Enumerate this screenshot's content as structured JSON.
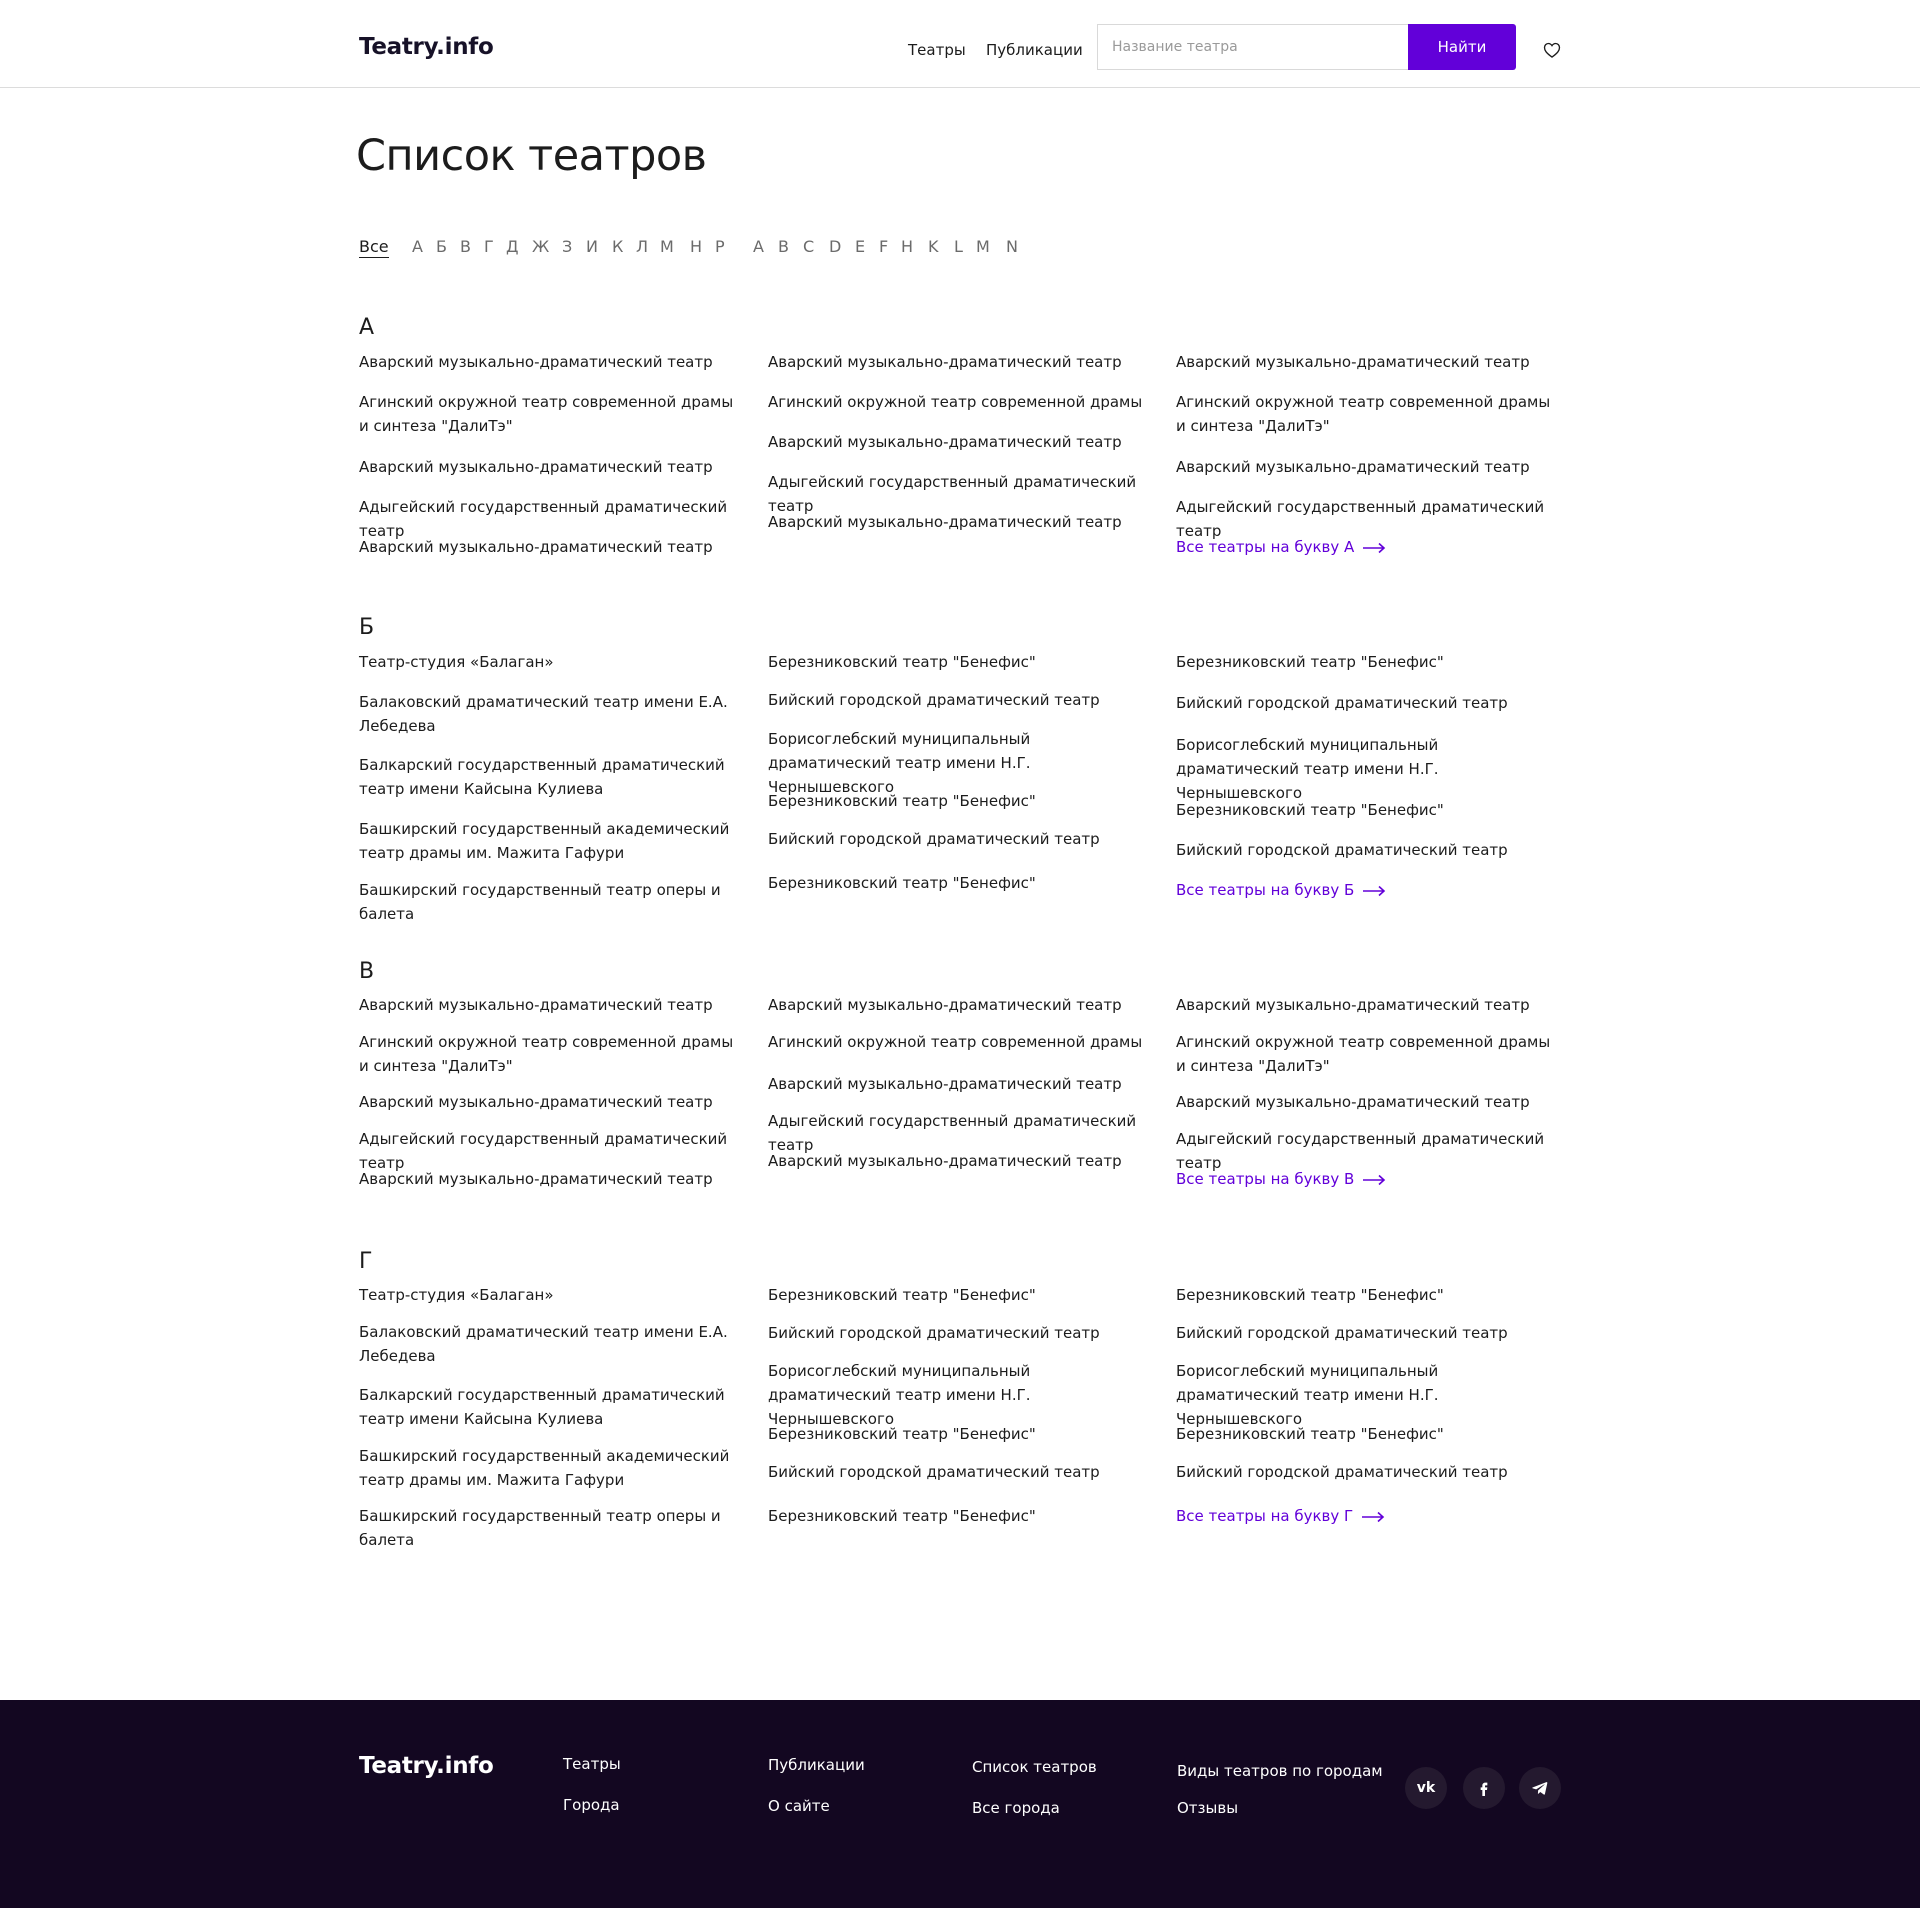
{
  "header": {
    "logo": "Teatry.info",
    "nav": [
      "Театры",
      "Публикации"
    ],
    "search_placeholder": "Название театра",
    "search_button": "Найти",
    "favorites_icon": "heart-icon"
  },
  "page_title": "Список театров",
  "alphabet": {
    "all_label": "Все",
    "cyrillic": [
      "А",
      "Б",
      "В",
      "Г",
      "Д",
      "Ж",
      "З",
      "И",
      "К",
      "Л",
      "М",
      "Н",
      "Р"
    ],
    "latin": [
      "A",
      "B",
      "C",
      "D",
      "E",
      "F",
      "H",
      "K",
      "L",
      "M",
      "N"
    ]
  },
  "sections": [
    {
      "letter": "А",
      "columns": [
        [
          "Аварский музыкально-драматический театр",
          "Агинский окружной театр современной драмы и синтеза \"ДалиТэ\"",
          "Аварский музыкально-драматический театр",
          "Адыгейский государственный драматический театр",
          "Аварский музыкально-драматический театр"
        ],
        [
          "Аварский музыкально-драматический театр",
          "Агинский окружной театр современной драмы",
          "Аварский музыкально-драматический театр",
          "Адыгейский государственный драматический театр",
          "Аварский музыкально-драматический театр"
        ],
        [
          "Аварский музыкально-драматический театр",
          "Агинский окружной театр современной драмы и синтеза \"ДалиТэ\"",
          "Аварский музыкально-драматический театр",
          "Адыгейский государственный драматический театр"
        ]
      ],
      "more": "Все театры на букву А"
    },
    {
      "letter": "Б",
      "columns": [
        [
          "Театр-студия «Балаган»",
          "Балаковский драматический театр имени Е.А. Лебедева",
          "Балкарский государственный драматический театр имени Кайсына Кулиева",
          "Башкирский государственный академический театр драмы им. Мажита Гафури",
          "Башкирский государственный театр оперы и балета"
        ],
        [
          "Березниковский театр \"Бенефис\"",
          "Бийский городской драматический театр",
          "Борисоглебский муниципальный драматический театр имени Н.Г. Чернышевского",
          "Березниковский театр \"Бенефис\"",
          "Бийский городской драматический театр",
          "Березниковский театр \"Бенефис\""
        ],
        [
          "Березниковский театр \"Бенефис\"",
          "Бийский городской драматический театр",
          "Борисоглебский муниципальный драматический театр имени Н.Г. Чернышевского",
          "Березниковский театр \"Бенефис\"",
          "Бийский городской драматический театр"
        ]
      ],
      "more": "Все театры на букву Б"
    },
    {
      "letter": "В",
      "columns": [
        [
          "Аварский музыкально-драматический театр",
          "Агинский окружной театр современной драмы и синтеза \"ДалиТэ\"",
          "Аварский музыкально-драматический театр",
          "Адыгейский государственный драматический театр",
          "Аварский музыкально-драматический театр"
        ],
        [
          "Аварский музыкально-драматический театр",
          "Агинский окружной театр современной драмы",
          "Аварский музыкально-драматический театр",
          "Адыгейский государственный драматический театр",
          "Аварский музыкально-драматический театр"
        ],
        [
          "Аварский музыкально-драматический театр",
          "Агинский окружной театр современной драмы и синтеза \"ДалиТэ\"",
          "Аварский музыкально-драматический театр",
          "Адыгейский государственный драматический театр"
        ]
      ],
      "more": "Все театры на букву В"
    },
    {
      "letter": "Г",
      "columns": [
        [
          "Театр-студия «Балаган»",
          "Балаковский драматический театр имени Е.А. Лебедева",
          "Балкарский государственный драматический театр имени Кайсына Кулиева",
          "Башкирский государственный академический театр драмы им. Мажита Гафури",
          "Башкирский государственный театр оперы и балета"
        ],
        [
          "Березниковский театр \"Бенефис\"",
          "Бийский городской драматический театр",
          "Борисоглебский муниципальный драматический театр имени Н.Г. Чернышевского",
          "Березниковский театр \"Бенефис\"",
          "Бийский городской драматический театр",
          "Березниковский театр \"Бенефис\""
        ],
        [
          "Березниковский театр \"Бенефис\"",
          "Бийский городской драматический театр",
          "Борисоглебский муниципальный драматический театр имени Н.Г. Чернышевского",
          "Березниковский театр \"Бенефис\"",
          "Бийский городской драматический театр"
        ]
      ],
      "more": "Все театры на букву Г"
    }
  ],
  "footer": {
    "logo": "Teatry.info",
    "links": [
      "Театры",
      "Города",
      "Публикации",
      "О сайте",
      "Список театров",
      "Все города",
      "Виды театров по городам",
      "Отзывы"
    ],
    "social": [
      {
        "icon": "vk-icon",
        "glyph": "vk"
      },
      {
        "icon": "facebook-icon",
        "glyph": "f"
      },
      {
        "icon": "telegram-icon",
        "glyph": ""
      }
    ]
  },
  "colors": {
    "accent": "#6200d9",
    "footer_bg": "#130721",
    "text": "#1c1c1c",
    "muted": "#6b6b6b"
  }
}
